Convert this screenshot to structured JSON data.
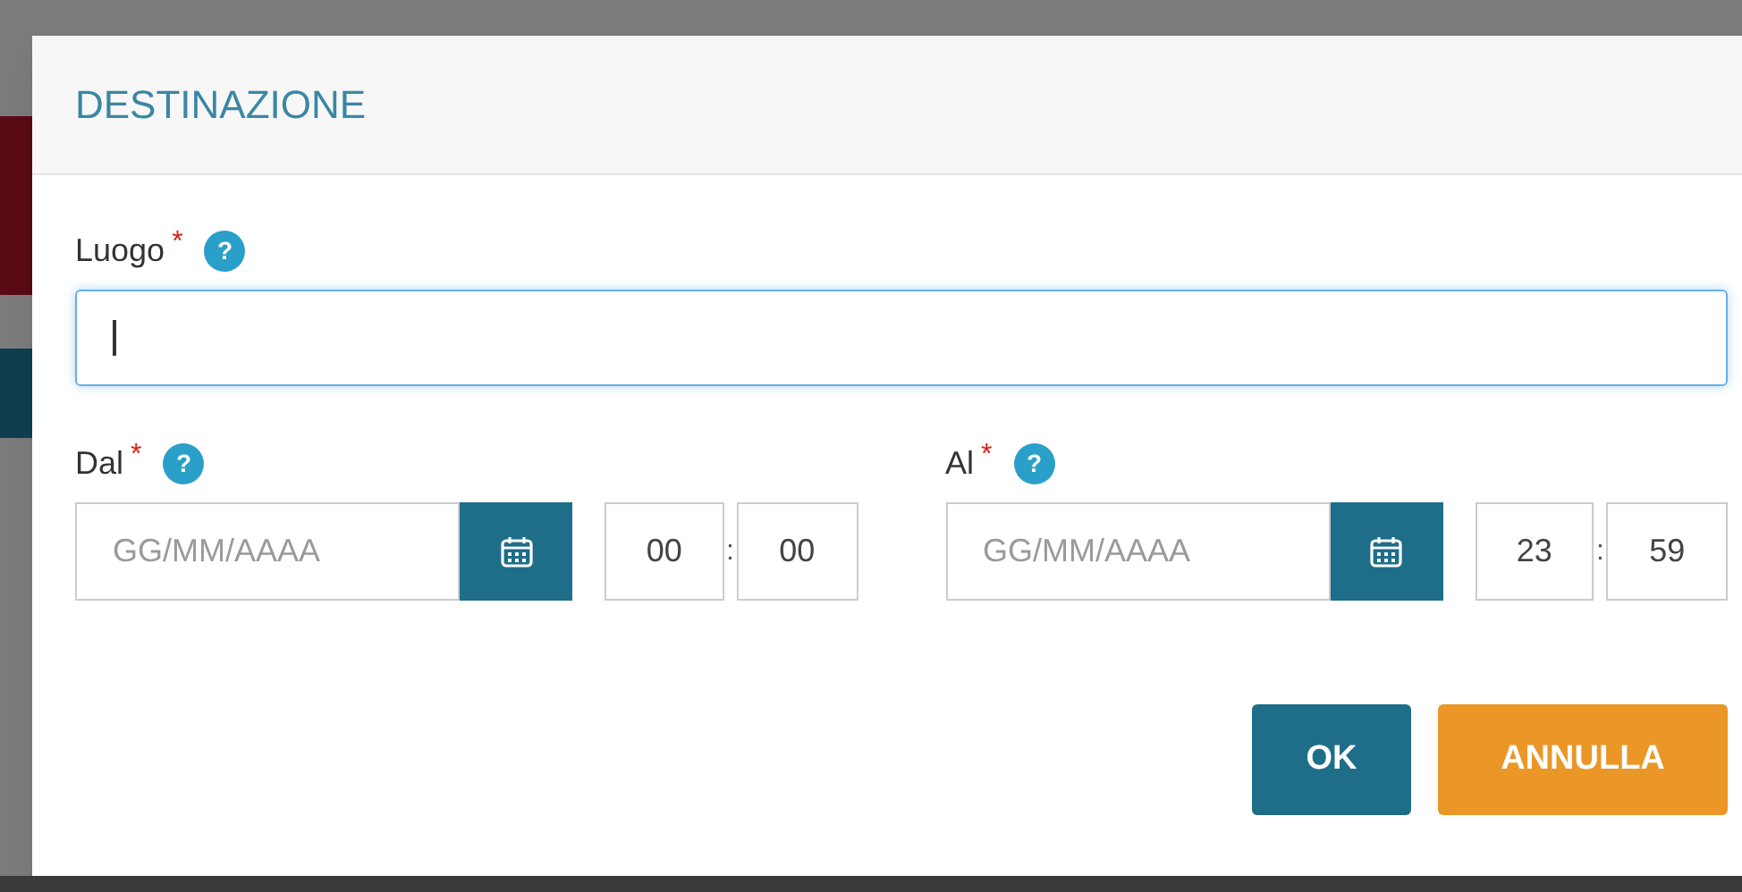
{
  "dialog": {
    "title": "DESTINAZIONE"
  },
  "place": {
    "label": "Luogo",
    "required_mark": "*",
    "help": "?",
    "focused": true
  },
  "ranges": [
    {
      "label": "Dal",
      "required_mark": "*",
      "help": "?",
      "date_placeholder": "GG/MM/AAAA",
      "hours": "00",
      "separator": ":",
      "minutes": "00"
    },
    {
      "label": "Al",
      "required_mark": "*",
      "help": "?",
      "date_placeholder": "GG/MM/AAAA",
      "hours": "23",
      "separator": ":",
      "minutes": "59"
    }
  ],
  "buttons": [
    {
      "label": "OK",
      "kind": "primary"
    },
    {
      "label": "ANNULLA",
      "kind": "cancel"
    }
  ]
}
